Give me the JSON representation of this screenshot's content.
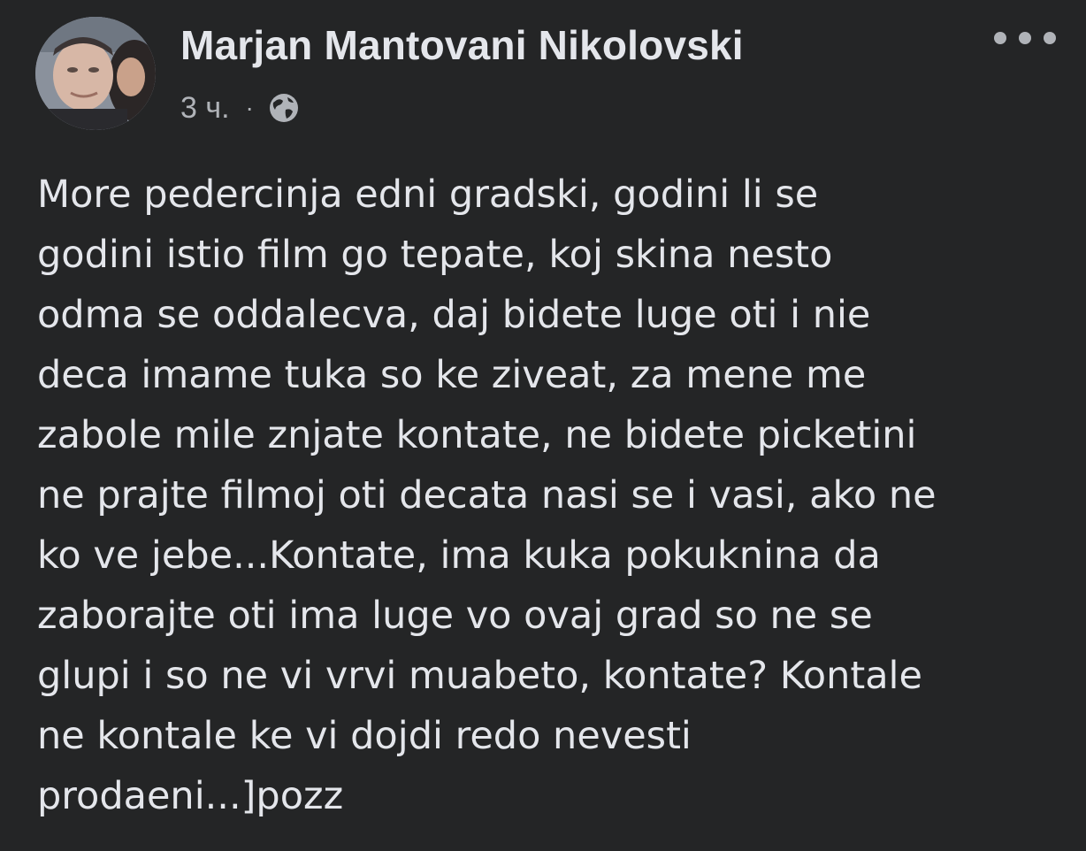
{
  "post": {
    "author": "Marjan Mantovani Nikolovski",
    "time": "3 ч.",
    "separator": "·",
    "privacy_icon": "globe-icon",
    "more_icon": "more-options-icon",
    "lines": [
      "More pedercinja edni gradski, godini li se",
      "godini istio film go tepate, koj skina nesto",
      "odma se oddalecva, daj bidete luge oti i nie",
      "deca imame tuka so ke ziveat, za mene me",
      "zabole mile znjate kontate, ne bidete picketini",
      "ne prajte filmoj oti decata nasi se i vasi, ako ne",
      "ko ve jebe...Kontate, ima kuka pokuknina da",
      "zaborajte oti ima luge vo ovaj grad so ne se",
      "glupi i so ne vi vrvi muabeto, kontate? Kontale",
      "ne kontale ke vi dojdi redo nevesti",
      "prodaeni...]pozz"
    ]
  },
  "colors": {
    "background": "#242526",
    "primary_text": "#e4e6eb",
    "secondary_text": "#b0b3b8"
  }
}
